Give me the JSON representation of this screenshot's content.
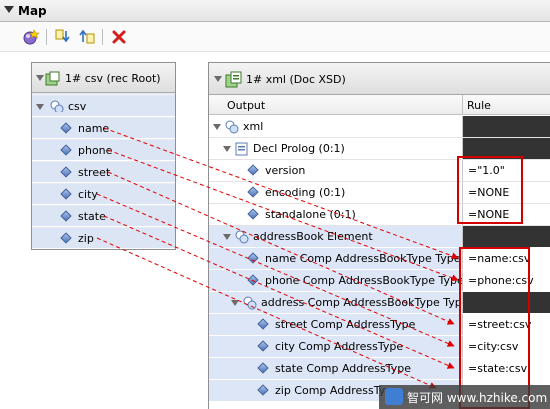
{
  "header": {
    "title": "Map"
  },
  "toolbar": {
    "icons": [
      "run-map-icon",
      "move-down-icon",
      "move-up-icon",
      "delete-icon"
    ]
  },
  "left_panel": {
    "title": "1# csv (rec Root)",
    "root": "csv",
    "fields": [
      "name",
      "phone",
      "street",
      "city",
      "state",
      "zip"
    ]
  },
  "right_panel": {
    "title": "1# xml (Doc XSD)",
    "columns": {
      "output": "Output",
      "rule": "Rule"
    },
    "rows": [
      {
        "label": "xml",
        "rule": ""
      },
      {
        "label": "Decl Prolog (0:1)",
        "rule": ""
      },
      {
        "label": "version",
        "rule": "=\"1.0\""
      },
      {
        "label": "encoding (0:1)",
        "rule": "=NONE"
      },
      {
        "label": "standalone (0:1)",
        "rule": "=NONE"
      },
      {
        "label": "addressBook Element",
        "rule": ""
      },
      {
        "label": "name Comp AddressBookType Type",
        "rule": "=name:csv"
      },
      {
        "label": "phone Comp AddressBookType Type",
        "rule": "=phone:csv"
      },
      {
        "label": "address Comp AddressBookType Type",
        "rule": ""
      },
      {
        "label": "street Comp AddressType",
        "rule": "=street:csv"
      },
      {
        "label": "city Comp AddressType",
        "rule": "=city:csv"
      },
      {
        "label": "state Comp AddressType",
        "rule": "=state:csv"
      },
      {
        "label": "zip Comp AddressType",
        "rule": ""
      }
    ]
  },
  "colors": {
    "link_arrow": "#e00000",
    "highlight": "#d40000",
    "row_blue": "#dde6f6",
    "dark_cell": "#333333"
  },
  "watermark": {
    "text": "智可网 www.hzhike.com"
  }
}
